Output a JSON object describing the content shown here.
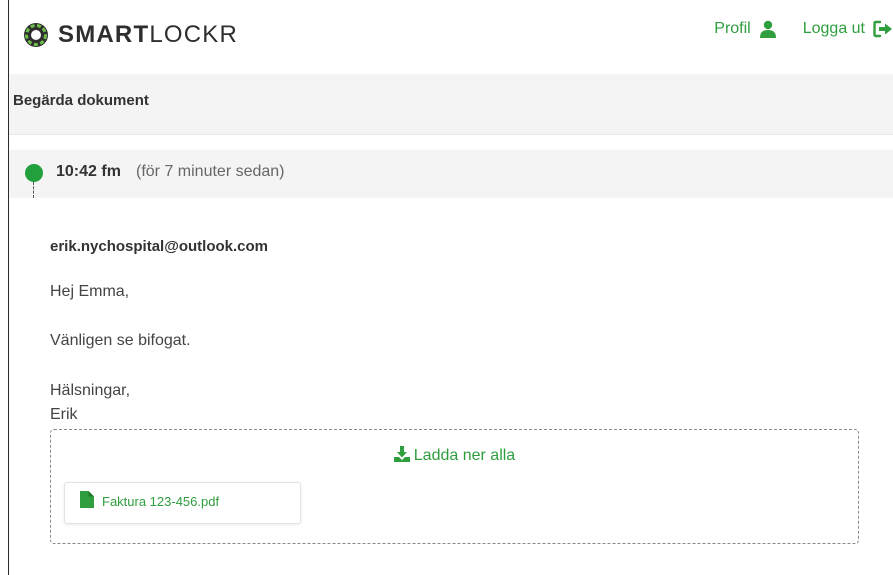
{
  "header": {
    "logo": {
      "text_bold": "SMART",
      "text_light": "LOCKR"
    },
    "nav": {
      "profile_label": "Profil",
      "logout_label": "Logga ut"
    }
  },
  "page": {
    "title": "Begärda dokument"
  },
  "timeline": {
    "time": "10:42 fm",
    "relative": "(för 7 minuter sedan)"
  },
  "message": {
    "sender": "erik.nychospital@outlook.com",
    "greeting": "Hej Emma,",
    "body": "Vänligen se bifogat.",
    "closing": "Hälsningar,",
    "signature": "Erik"
  },
  "attachments": {
    "download_all_label": "Ladda ner alla",
    "files": [
      {
        "name": "Faktura 123-456.pdf"
      }
    ]
  },
  "icons": {
    "logo": "smartlockr-logo-icon",
    "profile": "user-icon",
    "logout": "sign-out-icon",
    "download": "download-icon",
    "file": "file-icon"
  },
  "colors": {
    "accent": "#2f9e3f",
    "timeline_dot": "#22a03c",
    "header_bg": "#f4f4f4"
  }
}
